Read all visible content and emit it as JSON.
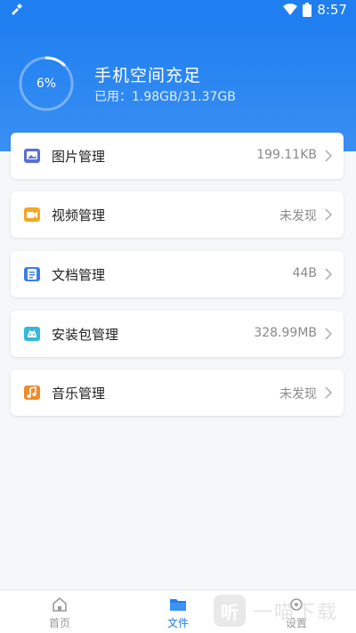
{
  "status_bar": {
    "time": "8:57"
  },
  "storage": {
    "percent_label": "6%",
    "percent_value": 0.06,
    "title": "手机空间充足",
    "usage": "已用：1.98GB/31.37GB"
  },
  "categories": [
    {
      "label": "图片管理",
      "value": "199.11KB",
      "icon": "image-icon",
      "color": "#5b6fd6"
    },
    {
      "label": "视频管理",
      "value": "未发现",
      "icon": "video-icon",
      "color": "#f5a623"
    },
    {
      "label": "文档管理",
      "value": "44B",
      "icon": "document-icon",
      "color": "#3c7ee6"
    },
    {
      "label": "安装包管理",
      "value": "328.99MB",
      "icon": "android-icon",
      "color": "#36b8d9"
    },
    {
      "label": "音乐管理",
      "value": "未发现",
      "icon": "music-icon",
      "color": "#f08a2b"
    }
  ],
  "bottom_nav": {
    "items": [
      {
        "label": "首页",
        "icon": "home-icon",
        "active": false
      },
      {
        "label": "文件",
        "icon": "folder-icon",
        "active": true
      },
      {
        "label": "设置",
        "icon": "settings-icon",
        "active": false
      }
    ]
  },
  "watermark": {
    "text": "一喵下载"
  },
  "colors": {
    "primary": "#1f7ff0",
    "inactive": "#9a9a9a"
  }
}
